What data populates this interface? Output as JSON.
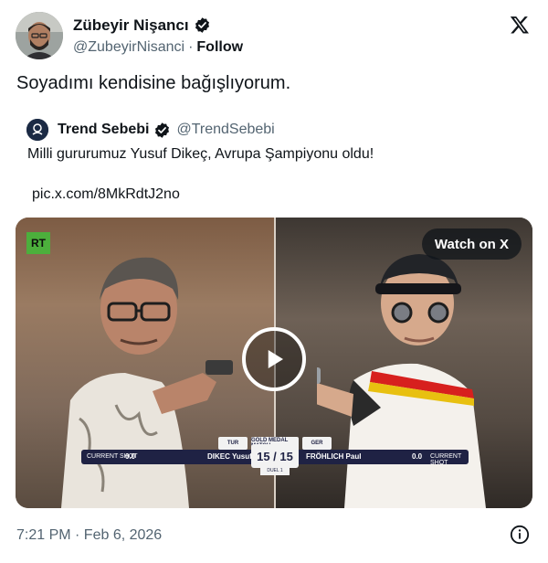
{
  "author": {
    "name": "Zübeyir Nişancı",
    "handle": "@ZubeyirNisanci",
    "separator": "·",
    "follow_label": "Follow"
  },
  "tweet": {
    "text": "Soyadımı kendisine bağışlıyorum."
  },
  "quote": {
    "name": "Trend Sebebi",
    "handle": "@TrendSebebi",
    "text": "Milli gururumuz Yusuf Dikeç, Avrupa Şampiyonu oldu!",
    "link": "pic.x.com/8MkRdtJ2no"
  },
  "media": {
    "watermark": "RT",
    "watch_label": "Watch on X",
    "scoreboard": {
      "left_country": "TUR",
      "right_country": "GER",
      "match_title": "GOLD MEDAL MATCH",
      "left_shot_label": "CURRENT SHOT",
      "left_shot_value": "0.0",
      "left_name": "DIKEC Yusuf",
      "right_name": "FRÖHLICH Paul",
      "right_shot_value": "0.0",
      "right_shot_label": "CURRENT SHOT",
      "score": "15 / 15",
      "duel": "DUEL 1"
    }
  },
  "footer": {
    "timestamp": "7:21 PM · Feb 6, 2026"
  },
  "colors": {
    "verified": "#1d9bf0",
    "secondary_text": "#536471",
    "primary_text": "#0f1419"
  }
}
